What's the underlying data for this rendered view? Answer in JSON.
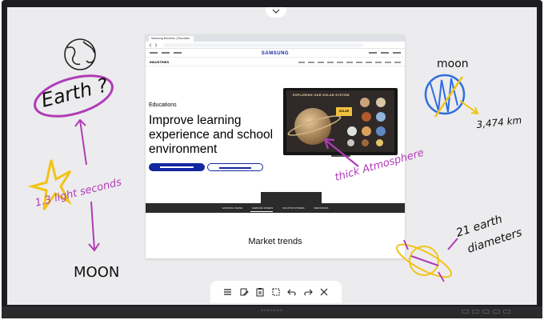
{
  "browser": {
    "tab_title": "Samsung Business | Education",
    "logo": "SAMSUNG",
    "subnav_label": "INDUSTRIES"
  },
  "page": {
    "category": "Educations",
    "hero_title": "Improve learning experience and school environment",
    "tv_headline": "EXPLORING OUR SOLAR SYSTEM",
    "tv_badge": "SOLAR",
    "band_links": [
      "SAMSUNG ONLINE",
      "SAMSUNG OFFERS",
      "SOLUTION STORIES",
      "RESOURCES"
    ],
    "section_title": "Market trends"
  },
  "annotations": {
    "earth": "Earth ?",
    "light_seconds": "1.3 light seconds",
    "moon_bottom": "MOON",
    "moon_top": "moon",
    "moon_distance": "3,474 km",
    "atmosphere": "thick Atmosphere",
    "earth_diameters_1": "21 earth",
    "earth_diameters_2": "diameters"
  },
  "brand_strip": "SAMSUNG",
  "toolbar": {
    "tools": [
      "menu-icon",
      "pen-icon",
      "clipboard-icon",
      "select-icon",
      "undo-icon",
      "redo-icon",
      "close-icon"
    ]
  },
  "colors": {
    "ink_purple": "#b13bb8",
    "ink_yellow": "#f2c318",
    "ink_blue": "#2f6de0",
    "samsung_blue": "#1428a0"
  }
}
